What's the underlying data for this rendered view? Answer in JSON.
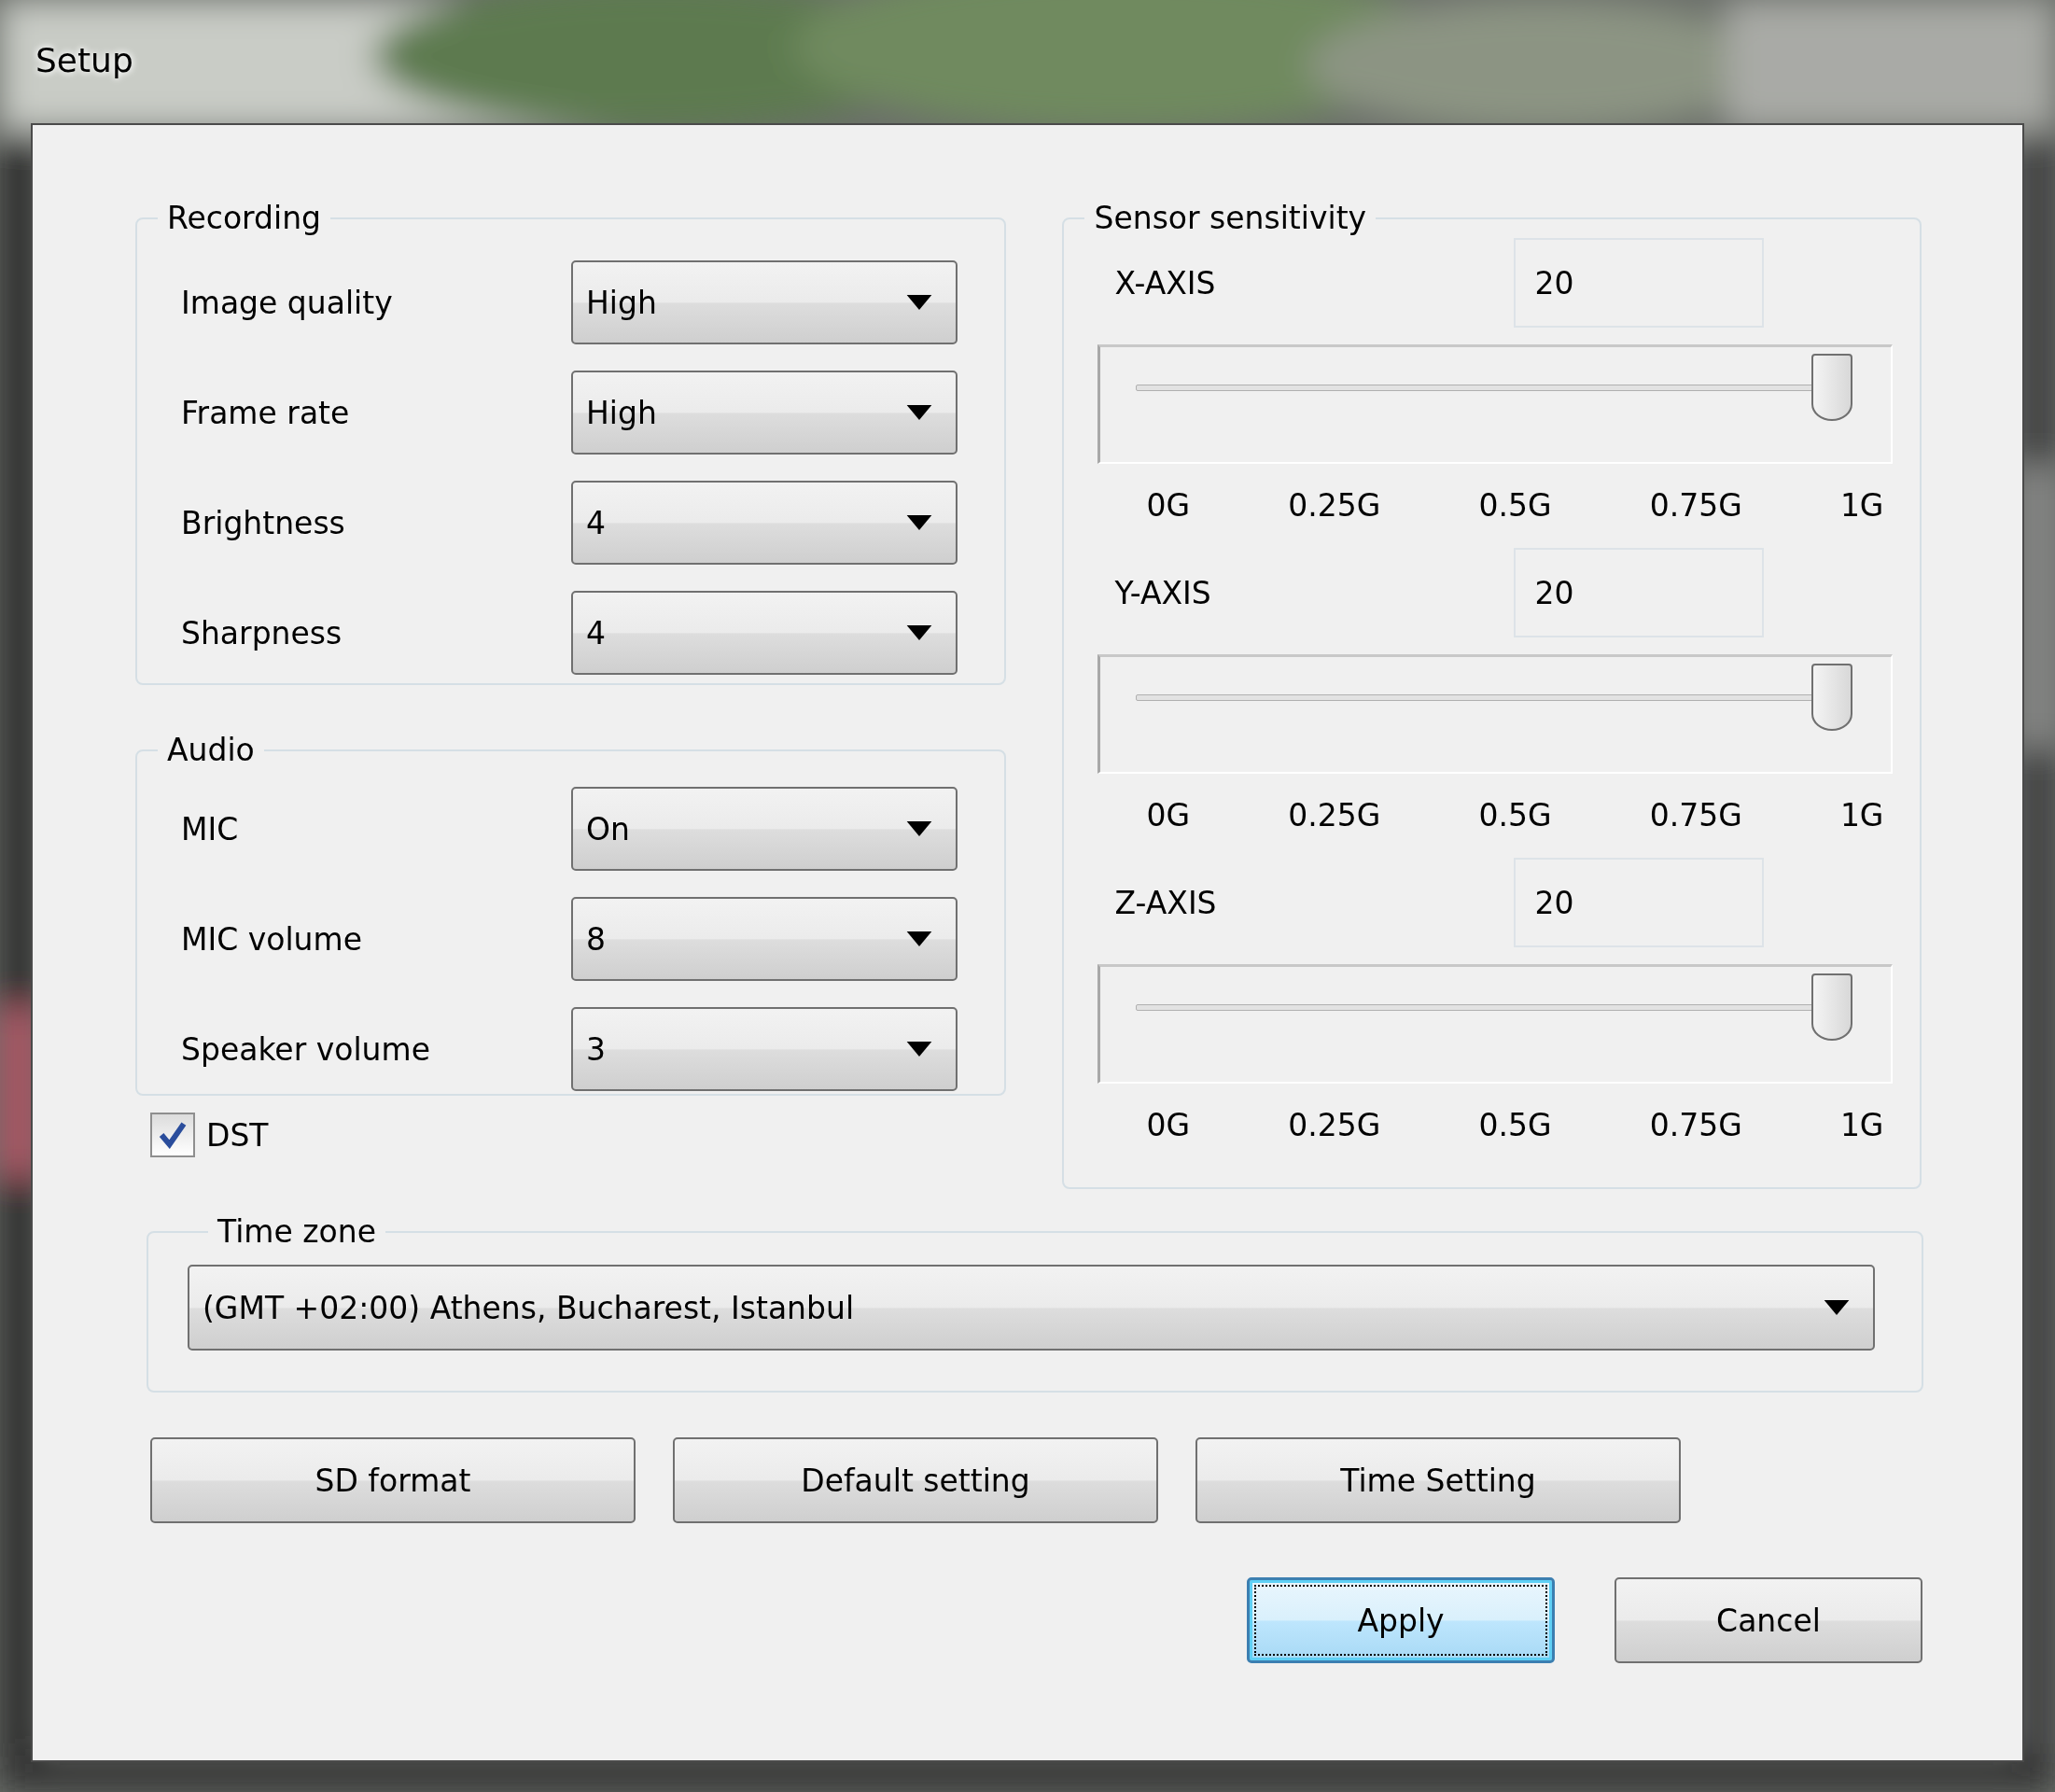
{
  "window": {
    "title": "Setup"
  },
  "recording": {
    "title": "Recording",
    "fields": [
      {
        "label": "Image quality",
        "value": "High"
      },
      {
        "label": "Frame rate",
        "value": "High"
      },
      {
        "label": "Brightness",
        "value": "4"
      },
      {
        "label": "Sharpness",
        "value": "4"
      }
    ]
  },
  "audio": {
    "title": "Audio",
    "fields": [
      {
        "label": "MIC",
        "value": "On"
      },
      {
        "label": "MIC volume",
        "value": "8"
      },
      {
        "label": "Speaker volume",
        "value": "3"
      }
    ]
  },
  "dst": {
    "label": "DST",
    "checked": true
  },
  "sensor": {
    "title": "Sensor sensitivity",
    "axes": [
      {
        "label": "X-AXIS",
        "value": "20",
        "level": 1,
        "ticks": [
          "0G",
          "0.25G",
          "0.5G",
          "0.75G",
          "1G"
        ]
      },
      {
        "label": "Y-AXIS",
        "value": "20",
        "level": 1,
        "ticks": [
          "0G",
          "0.25G",
          "0.5G",
          "0.75G",
          "1G"
        ]
      },
      {
        "label": "Z-AXIS",
        "value": "20",
        "level": 1,
        "ticks": [
          "0G",
          "0.25G",
          "0.5G",
          "0.75G",
          "1G"
        ]
      }
    ]
  },
  "time_zone": {
    "title": "Time zone",
    "value": "(GMT +02:00) Athens, Bucharest, Istanbul"
  },
  "buttons": [
    {
      "label": "SD format"
    },
    {
      "label": "Default setting"
    },
    {
      "label": "Time Setting"
    }
  ],
  "dialog_buttons": [
    {
      "label": "Apply",
      "focused": true
    },
    {
      "label": "Cancel",
      "focused": false
    }
  ]
}
